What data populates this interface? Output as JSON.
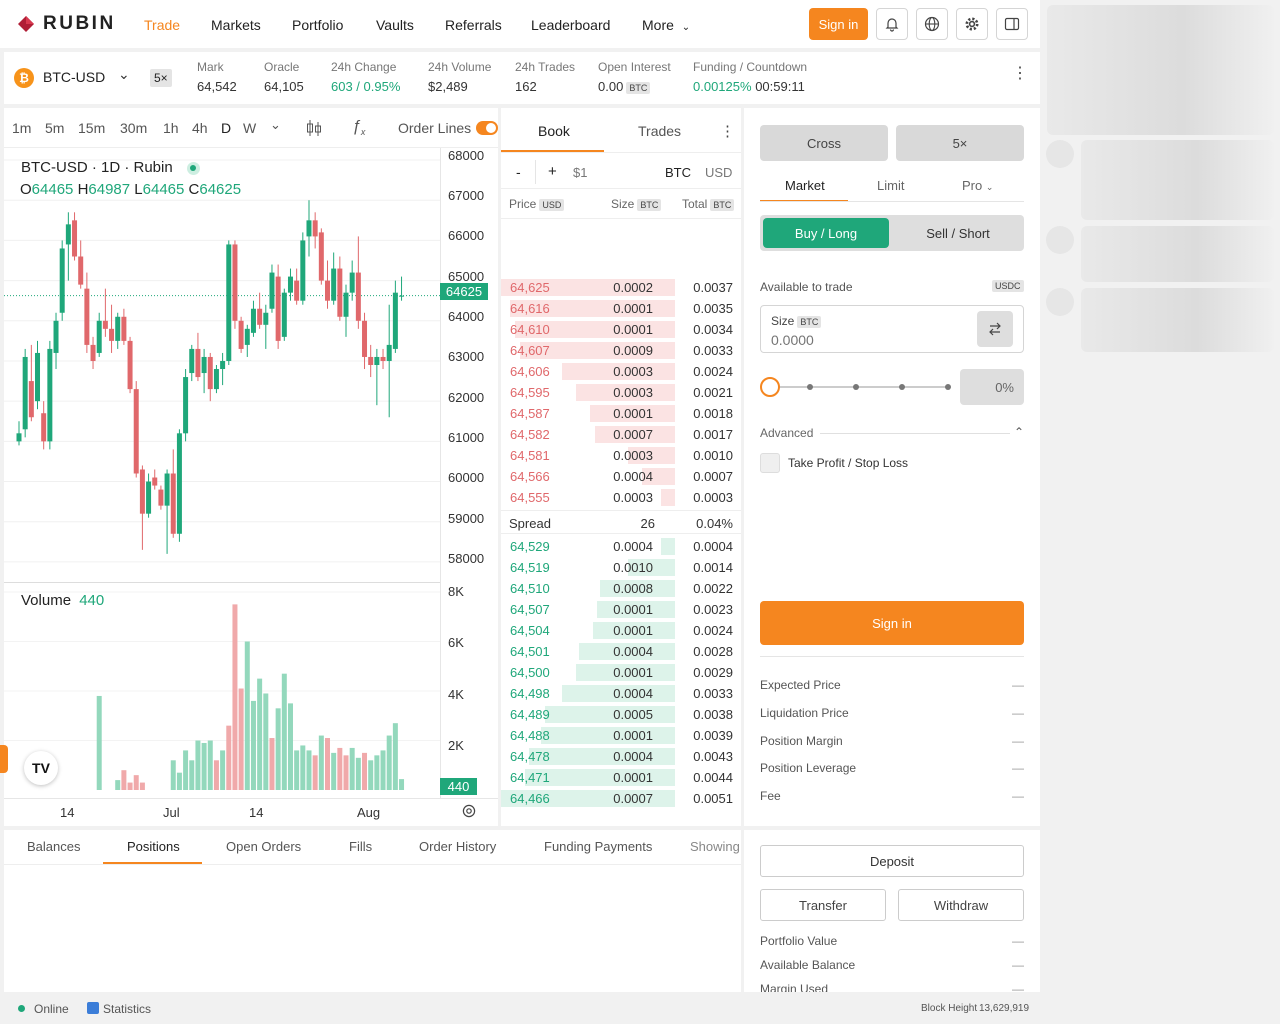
{
  "brand": {
    "name": "RUBIN"
  },
  "nav": {
    "items": [
      "Trade",
      "Markets",
      "Portfolio",
      "Vaults",
      "Referrals",
      "Leaderboard",
      "More"
    ],
    "sign_in": "Sign in",
    "accent": "#f5861f"
  },
  "market": {
    "symbol": "BTC-USD",
    "leverage": "5×",
    "stats": [
      {
        "label": "Mark",
        "value": "64,542"
      },
      {
        "label": "Oracle",
        "value": "64,105"
      },
      {
        "label": "24h Change",
        "value": "603 / 0.95%"
      },
      {
        "label": "24h Volume",
        "value": "$2,489"
      },
      {
        "label": "24h Trades",
        "value": "162"
      },
      {
        "label": "Open Interest",
        "value": "0.00",
        "tag": "BTC"
      },
      {
        "label": "Funding / Countdown",
        "value": "0.00125%",
        "value2": "00:59:11"
      }
    ]
  },
  "chart": {
    "intervals": [
      "1m",
      "5m",
      "15m",
      "30m",
      "1h",
      "4h",
      "D",
      "W"
    ],
    "order_lines_label": "Order Lines",
    "legend_title": "BTC-USD · 1D · Rubin",
    "ohlc": {
      "o_label": "O",
      "o": "64465",
      "h_label": "H",
      "h": "64987",
      "l_label": "L",
      "l": "64465",
      "c_label": "C",
      "c": "64625"
    },
    "price_axis": [
      "68000",
      "67000",
      "66000",
      "65000",
      "64000",
      "63000",
      "62000",
      "61000",
      "60000",
      "59000",
      "58000"
    ],
    "current_price": "64625",
    "volume_label": "Volume",
    "volume_value": "440",
    "volume_axis": [
      "8K",
      "6K",
      "4K",
      "2K"
    ],
    "volume_current": "440",
    "time_axis": [
      "14",
      "Jul",
      "14",
      "Aug"
    ]
  },
  "chart_data": {
    "type": "candlestick",
    "ylim": [
      57500,
      68300
    ],
    "candles": [
      [
        61000,
        61500,
        60900,
        61200
      ],
      [
        61300,
        63300,
        61100,
        63100
      ],
      [
        62500,
        63400,
        61500,
        61600
      ],
      [
        62000,
        63500,
        61800,
        63200
      ],
      [
        61700,
        62000,
        60800,
        61000
      ],
      [
        61000,
        63500,
        60800,
        63300
      ],
      [
        63200,
        64200,
        62800,
        64000
      ],
      [
        64200,
        66000,
        64000,
        65800
      ],
      [
        65900,
        66700,
        65000,
        66400
      ],
      [
        66500,
        66700,
        65500,
        65600
      ],
      [
        65600,
        66000,
        64800,
        64900
      ],
      [
        64800,
        65200,
        63200,
        63400
      ],
      [
        63400,
        63600,
        62800,
        63000
      ],
      [
        63200,
        64200,
        63100,
        64000
      ],
      [
        64000,
        64800,
        63600,
        63800
      ],
      [
        63800,
        64400,
        63200,
        63500
      ],
      [
        63500,
        64200,
        63300,
        64100
      ],
      [
        64100,
        64300,
        63400,
        63500
      ],
      [
        63500,
        63600,
        62200,
        62300
      ],
      [
        62300,
        62500,
        60100,
        60200
      ],
      [
        60300,
        60400,
        58300,
        59200
      ],
      [
        59200,
        60200,
        59100,
        60000
      ],
      [
        60100,
        60300,
        59800,
        59900
      ],
      [
        59800,
        59900,
        59300,
        59400
      ],
      [
        59400,
        60300,
        58200,
        60200
      ],
      [
        60200,
        60800,
        58600,
        58700
      ],
      [
        58700,
        61300,
        58500,
        61200
      ],
      [
        61200,
        62800,
        61000,
        62600
      ],
      [
        62700,
        63400,
        62500,
        63300
      ],
      [
        63300,
        63700,
        62500,
        62600
      ],
      [
        62700,
        63300,
        62200,
        63100
      ],
      [
        63100,
        63200,
        62000,
        62300
      ],
      [
        62300,
        62900,
        62200,
        62800
      ],
      [
        62800,
        63200,
        62400,
        63000
      ],
      [
        63000,
        66000,
        62900,
        65900
      ],
      [
        65900,
        66000,
        63800,
        64000
      ],
      [
        64000,
        64100,
        63200,
        63300
      ],
      [
        63400,
        63900,
        63100,
        63800
      ],
      [
        63700,
        64500,
        63600,
        64300
      ],
      [
        64300,
        64700,
        63800,
        63900
      ],
      [
        63900,
        64400,
        63300,
        64200
      ],
      [
        64300,
        65400,
        64200,
        65200
      ],
      [
        65100,
        65400,
        63300,
        63500
      ],
      [
        63600,
        64800,
        63500,
        64700
      ],
      [
        64700,
        65300,
        64500,
        65100
      ],
      [
        65000,
        65300,
        64400,
        64500
      ],
      [
        64500,
        66200,
        64400,
        66000
      ],
      [
        66100,
        67000,
        65600,
        66500
      ],
      [
        66500,
        66700,
        65800,
        66100
      ],
      [
        66200,
        66300,
        64900,
        65000
      ],
      [
        65000,
        65500,
        64300,
        64500
      ],
      [
        64500,
        65700,
        64400,
        65300
      ],
      [
        65300,
        65600,
        64000,
        64100
      ],
      [
        64100,
        64900,
        63600,
        64700
      ],
      [
        64700,
        65500,
        64500,
        65200
      ],
      [
        65200,
        66100,
        63800,
        64000
      ],
      [
        64000,
        64200,
        62800,
        63100
      ],
      [
        63100,
        63400,
        62600,
        62900
      ],
      [
        62900,
        63300,
        61900,
        63100
      ],
      [
        63100,
        63300,
        62800,
        63000
      ],
      [
        63000,
        64400,
        61600,
        63400
      ],
      [
        63300,
        65000,
        63200,
        64700
      ],
      [
        64600,
        65100,
        64500,
        64625
      ]
    ],
    "volume_ylim": [
      0,
      8000
    ],
    "volumes": [
      {
        "v": 0,
        "up": true
      },
      {
        "v": 0,
        "up": true
      },
      {
        "v": 0,
        "up": true
      },
      {
        "v": 0,
        "up": true
      },
      {
        "v": 0,
        "up": false
      },
      {
        "v": 0,
        "up": true
      },
      {
        "v": 0,
        "up": true
      },
      {
        "v": 0,
        "up": true
      },
      {
        "v": 0,
        "up": true
      },
      {
        "v": 0,
        "up": false
      },
      {
        "v": 0,
        "up": false
      },
      {
        "v": 0,
        "up": false
      },
      {
        "v": 0,
        "up": false
      },
      {
        "v": 3800,
        "up": true
      },
      {
        "v": 0,
        "up": true
      },
      {
        "v": 0,
        "up": false
      },
      {
        "v": 400,
        "up": true
      },
      {
        "v": 800,
        "up": false
      },
      {
        "v": 300,
        "up": false
      },
      {
        "v": 600,
        "up": false
      },
      {
        "v": 300,
        "up": false
      },
      {
        "v": 0,
        "up": true
      },
      {
        "v": 0,
        "up": true
      },
      {
        "v": 0,
        "up": false
      },
      {
        "v": 0,
        "up": true
      },
      {
        "v": 1200,
        "up": true
      },
      {
        "v": 700,
        "up": true
      },
      {
        "v": 1600,
        "up": true
      },
      {
        "v": 1200,
        "up": true
      },
      {
        "v": 2000,
        "up": true
      },
      {
        "v": 1900,
        "up": true
      },
      {
        "v": 2000,
        "up": true
      },
      {
        "v": 1200,
        "up": false
      },
      {
        "v": 1600,
        "up": true
      },
      {
        "v": 2600,
        "up": false
      },
      {
        "v": 7500,
        "up": false
      },
      {
        "v": 4100,
        "up": false
      },
      {
        "v": 6000,
        "up": true
      },
      {
        "v": 3600,
        "up": true
      },
      {
        "v": 4500,
        "up": true
      },
      {
        "v": 3900,
        "up": true
      },
      {
        "v": 2100,
        "up": false
      },
      {
        "v": 3300,
        "up": true
      },
      {
        "v": 4700,
        "up": true
      },
      {
        "v": 3500,
        "up": true
      },
      {
        "v": 1600,
        "up": true
      },
      {
        "v": 1800,
        "up": true
      },
      {
        "v": 1600,
        "up": true
      },
      {
        "v": 1400,
        "up": false
      },
      {
        "v": 2200,
        "up": true
      },
      {
        "v": 2100,
        "up": false
      },
      {
        "v": 1500,
        "up": true
      },
      {
        "v": 1700,
        "up": false
      },
      {
        "v": 1400,
        "up": false
      },
      {
        "v": 1700,
        "up": true
      },
      {
        "v": 1300,
        "up": true
      },
      {
        "v": 1500,
        "up": false
      },
      {
        "v": 1200,
        "up": true
      },
      {
        "v": 1400,
        "up": true
      },
      {
        "v": 1600,
        "up": true
      },
      {
        "v": 2200,
        "up": true
      },
      {
        "v": 2700,
        "up": true
      },
      {
        "v": 440,
        "up": true
      }
    ],
    "colors": {
      "up": "#1fa77a",
      "down": "#e0686b",
      "up_vol": "#93d8bc",
      "down_vol": "#f0a9aa"
    }
  },
  "orderbook": {
    "tabs": [
      "Book",
      "Trades"
    ],
    "controls": {
      "minus": "-",
      "plus": "+",
      "tick": "$1",
      "unit_btc": "BTC",
      "unit_usd": "USD"
    },
    "headers": {
      "price": "Price",
      "price_tag": "USD",
      "size": "Size",
      "size_tag": "BTC",
      "total": "Total",
      "total_tag": "BTC"
    },
    "asks": [
      {
        "price": "64,625",
        "size": "0.0002",
        "total": "0.0037",
        "depth": 1.0
      },
      {
        "price": "64,616",
        "size": "0.0001",
        "total": "0.0035",
        "depth": 0.95
      },
      {
        "price": "64,610",
        "size": "0.0001",
        "total": "0.0034",
        "depth": 0.92
      },
      {
        "price": "64,607",
        "size": "0.0009",
        "total": "0.0033",
        "depth": 0.89
      },
      {
        "price": "64,606",
        "size": "0.0003",
        "total": "0.0024",
        "depth": 0.65
      },
      {
        "price": "64,595",
        "size": "0.0003",
        "total": "0.0021",
        "depth": 0.57
      },
      {
        "price": "64,587",
        "size": "0.0001",
        "total": "0.0018",
        "depth": 0.49
      },
      {
        "price": "64,582",
        "size": "0.0007",
        "total": "0.0017",
        "depth": 0.46
      },
      {
        "price": "64,581",
        "size": "0.0003",
        "total": "0.0010",
        "depth": 0.27
      },
      {
        "price": "64,566",
        "size": "0.0004",
        "total": "0.0007",
        "depth": 0.19
      },
      {
        "price": "64,555",
        "size": "0.0003",
        "total": "0.0003",
        "depth": 0.08
      }
    ],
    "spread": {
      "label": "Spread",
      "value": "26",
      "pct": "0.04%"
    },
    "bids": [
      {
        "price": "64,529",
        "size": "0.0004",
        "total": "0.0004",
        "depth": 0.08
      },
      {
        "price": "64,519",
        "size": "0.0010",
        "total": "0.0014",
        "depth": 0.27
      },
      {
        "price": "64,510",
        "size": "0.0008",
        "total": "0.0022",
        "depth": 0.43
      },
      {
        "price": "64,507",
        "size": "0.0001",
        "total": "0.0023",
        "depth": 0.45
      },
      {
        "price": "64,504",
        "size": "0.0001",
        "total": "0.0024",
        "depth": 0.47
      },
      {
        "price": "64,501",
        "size": "0.0004",
        "total": "0.0028",
        "depth": 0.55
      },
      {
        "price": "64,500",
        "size": "0.0001",
        "total": "0.0029",
        "depth": 0.57
      },
      {
        "price": "64,498",
        "size": "0.0004",
        "total": "0.0033",
        "depth": 0.65
      },
      {
        "price": "64,489",
        "size": "0.0005",
        "total": "0.0038",
        "depth": 0.75
      },
      {
        "price": "64,488",
        "size": "0.0001",
        "total": "0.0039",
        "depth": 0.77
      },
      {
        "price": "64,478",
        "size": "0.0004",
        "total": "0.0043",
        "depth": 0.84
      },
      {
        "price": "64,471",
        "size": "0.0001",
        "total": "0.0044",
        "depth": 0.86
      },
      {
        "price": "64,466",
        "size": "0.0007",
        "total": "0.0051",
        "depth": 1.0
      }
    ]
  },
  "trade_form": {
    "margin_mode": "Cross",
    "leverage": "5×",
    "order_types": [
      "Market",
      "Limit",
      "Pro"
    ],
    "buy_label": "Buy / Long",
    "sell_label": "Sell / Short",
    "available_label": "Available to trade",
    "available_tag": "USDC",
    "size_label": "Size",
    "size_tag": "BTC",
    "size_placeholder": "0.0000",
    "slider_pct": "0%",
    "advanced_label": "Advanced",
    "tpsl_label": "Take Profit / Stop Loss",
    "sign_in": "Sign in",
    "summary": [
      {
        "label": "Expected Price",
        "value": "—"
      },
      {
        "label": "Liquidation Price",
        "value": "—"
      },
      {
        "label": "Position Margin",
        "value": "—"
      },
      {
        "label": "Position Leverage",
        "value": "—"
      },
      {
        "label": "Fee",
        "value": "—"
      }
    ]
  },
  "bottom": {
    "tabs": [
      "Balances",
      "Positions",
      "Open Orders",
      "Fills",
      "Order History",
      "Funding Payments",
      "Showing"
    ],
    "active_tab": "Positions"
  },
  "account": {
    "deposit": "Deposit",
    "transfer": "Transfer",
    "withdraw": "Withdraw",
    "rows": [
      {
        "label": "Portfolio Value",
        "value": "—"
      },
      {
        "label": "Available Balance",
        "value": "—"
      },
      {
        "label": "Margin Used",
        "value": "—"
      }
    ]
  },
  "footer": {
    "status": "Online",
    "statistics": "Statistics",
    "block_label": "Block Height",
    "block_value": "13,629,919"
  }
}
